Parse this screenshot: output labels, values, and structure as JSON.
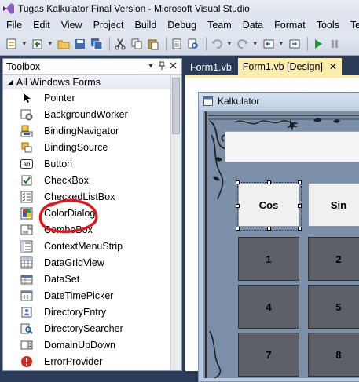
{
  "window": {
    "title": "Tugas Kalkulator Final Version - Microsoft Visual Studio"
  },
  "menu": [
    "File",
    "Edit",
    "View",
    "Project",
    "Build",
    "Debug",
    "Team",
    "Data",
    "Format",
    "Tools",
    "Test"
  ],
  "toolbox": {
    "title": "Toolbox",
    "pin_glyph": "▾",
    "section": "All Windows Forms",
    "items": [
      {
        "label": "Pointer",
        "icon": "pointer-icon"
      },
      {
        "label": "BackgroundWorker",
        "icon": "background-worker-icon"
      },
      {
        "label": "BindingNavigator",
        "icon": "binding-navigator-icon"
      },
      {
        "label": "BindingSource",
        "icon": "binding-source-icon"
      },
      {
        "label": "Button",
        "icon": "button-icon",
        "icon_text": "ab"
      },
      {
        "label": "CheckBox",
        "icon": "checkbox-icon"
      },
      {
        "label": "CheckedListBox",
        "icon": "checked-listbox-icon"
      },
      {
        "label": "ColorDialog",
        "icon": "color-dialog-icon"
      },
      {
        "label": "ComboBox",
        "icon": "combobox-icon"
      },
      {
        "label": "ContextMenuStrip",
        "icon": "context-menu-strip-icon"
      },
      {
        "label": "DataGridView",
        "icon": "datagridview-icon"
      },
      {
        "label": "DataSet",
        "icon": "dataset-icon"
      },
      {
        "label": "DateTimePicker",
        "icon": "datetimepicker-icon"
      },
      {
        "label": "DirectoryEntry",
        "icon": "directory-entry-icon"
      },
      {
        "label": "DirectorySearcher",
        "icon": "directory-searcher-icon"
      },
      {
        "label": "DomainUpDown",
        "icon": "domain-updown-icon"
      },
      {
        "label": "ErrorProvider",
        "icon": "error-provider-icon"
      }
    ]
  },
  "tabs": [
    {
      "label": "Form1.vb",
      "active": false
    },
    {
      "label": "Form1.vb [Design]",
      "active": true,
      "close": "✕"
    }
  ],
  "form": {
    "title": "Kalkulator",
    "keys": [
      {
        "label": "Cos",
        "style": "light",
        "selected": true
      },
      {
        "label": "Sin",
        "style": "light"
      },
      {
        "label": "1",
        "style": "dark"
      },
      {
        "label": "2",
        "style": "dark"
      },
      {
        "label": "4",
        "style": "dark"
      },
      {
        "label": "5",
        "style": "dark"
      },
      {
        "label": "7",
        "style": "dark"
      },
      {
        "label": "8",
        "style": "dark"
      }
    ]
  },
  "colors": {
    "ide_background": "#2b3c59",
    "active_tab": "#fcecad",
    "annotation_circle": "#e8141c"
  }
}
